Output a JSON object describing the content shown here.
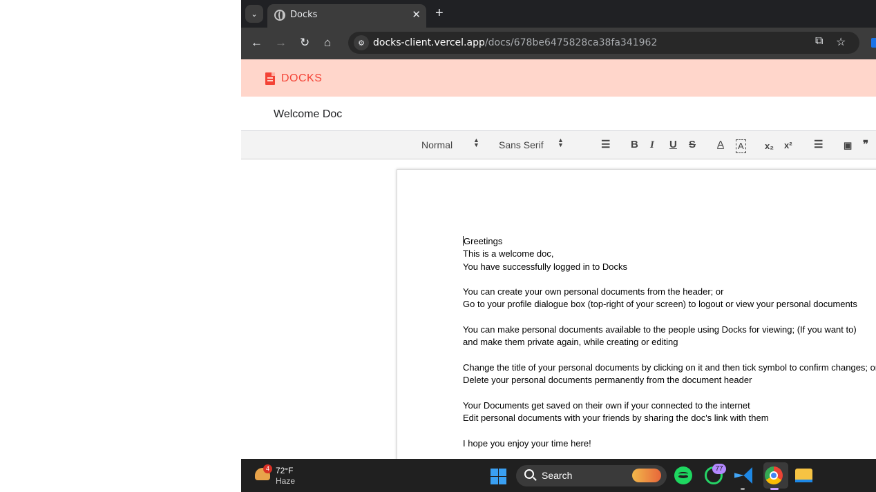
{
  "browser": {
    "tab_title": "Docks",
    "url_host": "docks-client.vercel.app",
    "url_path": "/docs/678be6475828ca38fa341962"
  },
  "app": {
    "brand": "DOCKS",
    "brand_color": "#f44336",
    "header_bg": "#ffd6cb",
    "document_title": "Welcome Doc"
  },
  "editor_toolbar": {
    "header_picker": "Normal",
    "font_picker": "Sans Serif",
    "bold": "B",
    "italic": "I",
    "underline": "U",
    "strike": "S",
    "subscript": "x₂",
    "superscript": "x²",
    "quote": "❞"
  },
  "document": {
    "lines": [
      "Greetings",
      "This is a welcome doc,",
      "You have successfully logged in to Docks",
      "",
      "You can create your own personal documents from the header; or",
      "Go to your profile dialogue box (top-right of your screen) to logout or view your personal documents",
      "",
      "You can make personal documents available to the people using Docks for viewing; (If you want to)",
      "and make them private again, while creating or editing",
      "",
      "Change the title of your personal documents by clicking on it and then tick symbol to confirm changes; or",
      "Delete your personal documents permanently from the document header",
      "",
      "Your Documents get saved on their own if your connected to the internet",
      "Edit personal documents with your friends by sharing the doc's link with them",
      "",
      "I hope you enjoy your time here!"
    ]
  },
  "taskbar": {
    "weather_temp": "72°F",
    "weather_desc": "Haze",
    "weather_badge": "4",
    "search_label": "Search",
    "whatsapp_badge": "77"
  }
}
